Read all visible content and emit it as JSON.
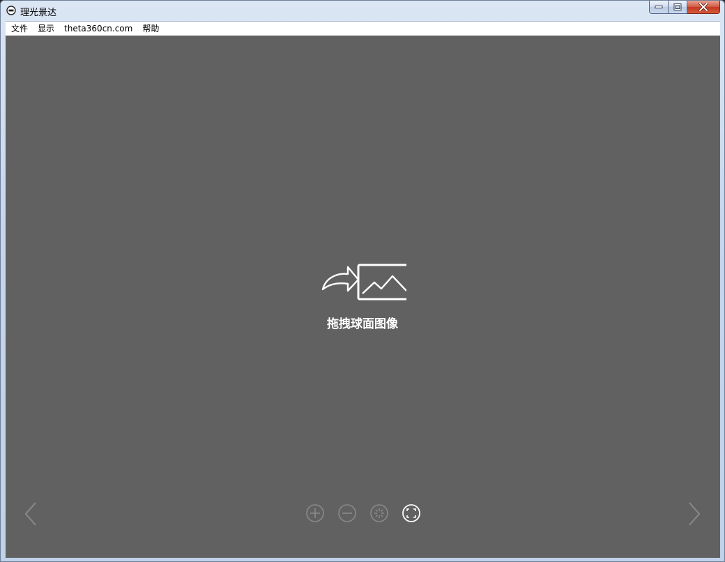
{
  "window": {
    "title": "理光景达"
  },
  "menubar": {
    "items": [
      {
        "label": "文件"
      },
      {
        "label": "显示"
      },
      {
        "label": "theta360cn.com"
      },
      {
        "label": "帮助"
      }
    ]
  },
  "viewer": {
    "drop_prompt": "拖拽球面图像",
    "background_color": "#616161"
  },
  "icons": {
    "app": "app-icon",
    "drop": "drag-image-icon",
    "prev": "chevron-left-icon",
    "next": "chevron-right-icon",
    "zoom_in": "zoom-in-icon",
    "zoom_out": "zoom-out-icon",
    "reset": "reset-view-icon",
    "fullscreen": "fullscreen-icon"
  }
}
